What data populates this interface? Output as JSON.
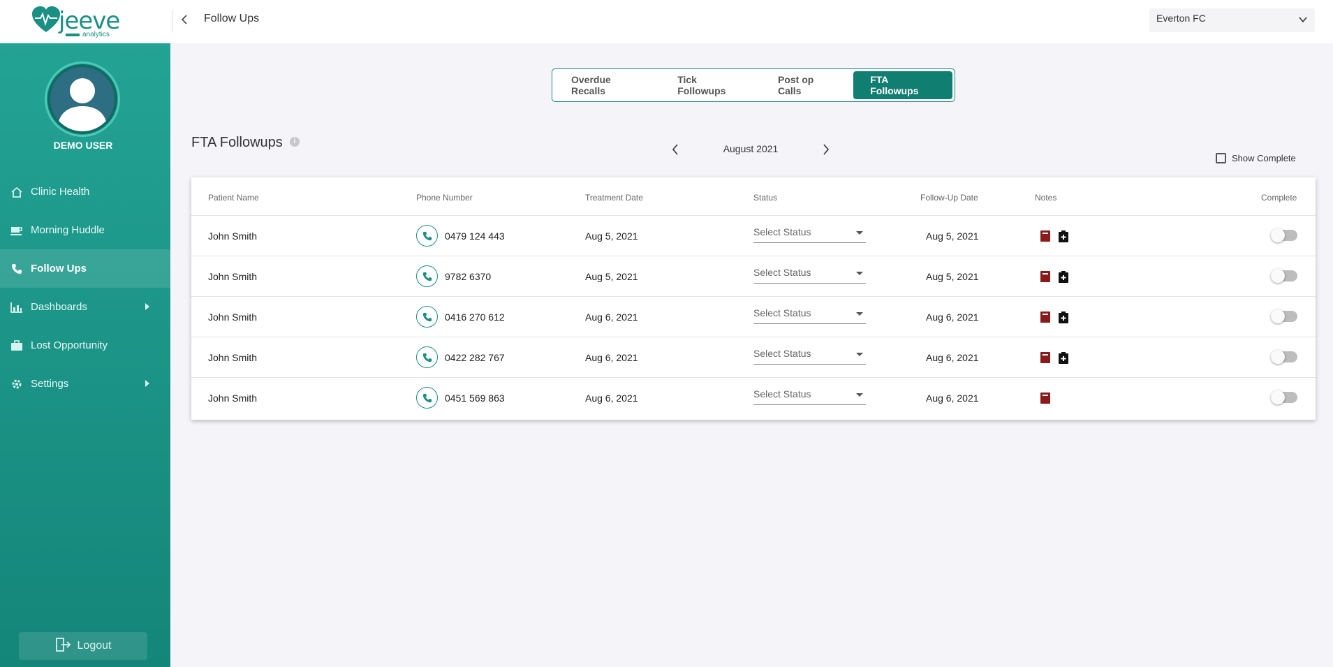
{
  "brand": {
    "name": "jeeve",
    "sub": "analytics",
    "color": "#1a8f84"
  },
  "header": {
    "title": "Follow Ups",
    "clinic": "Everton FC"
  },
  "sidebar": {
    "user": "DEMO USER",
    "items": [
      {
        "label": "Clinic Health",
        "icon": "home-icon"
      },
      {
        "label": "Morning Huddle",
        "icon": "coffee-icon"
      },
      {
        "label": "Follow Ups",
        "icon": "phone-icon",
        "active": true
      },
      {
        "label": "Dashboards",
        "icon": "chart-icon"
      },
      {
        "label": "Lost Opportunity",
        "icon": "briefcase-icon"
      },
      {
        "label": "Settings",
        "icon": "gear-icon"
      }
    ],
    "logout": "Logout"
  },
  "tabs": [
    "Overdue Recalls",
    "Tick Followups",
    "Post op Calls",
    "FTA Followups"
  ],
  "section": {
    "title": "FTA Followups",
    "month": "August 2021",
    "show_complete": "Show Complete"
  },
  "table": {
    "columns": [
      "Patient Name",
      "Phone Number",
      "Treatment Date",
      "Status",
      "Follow-Up Date",
      "Notes",
      "Complete"
    ],
    "rows": [
      {
        "name": "John Smith",
        "phone": "0479 124 443",
        "treatment": "Aug 5, 2021",
        "status": "Select Status",
        "followup": "Aug 5, 2021",
        "notes": 2
      },
      {
        "name": "John Smith",
        "phone": "9782 6370",
        "treatment": "Aug 5, 2021",
        "status": "Select Status",
        "followup": "Aug 5, 2021",
        "notes": 2
      },
      {
        "name": "John Smith",
        "phone": "0416 270 612",
        "treatment": "Aug 6, 2021",
        "status": "Select Status",
        "followup": "Aug 6, 2021",
        "notes": 2
      },
      {
        "name": "John Smith",
        "phone": "0422 282 767",
        "treatment": "Aug 6, 2021",
        "status": "Select Status",
        "followup": "Aug 6, 2021",
        "notes": 2
      },
      {
        "name": "John Smith",
        "phone": "0451 569 863",
        "treatment": "Aug 6, 2021",
        "status": "Select Status",
        "followup": "Aug 6, 2021",
        "notes": 1
      }
    ]
  },
  "colors": {
    "accent": "#117e72",
    "note_red": "#8b1a1a"
  }
}
